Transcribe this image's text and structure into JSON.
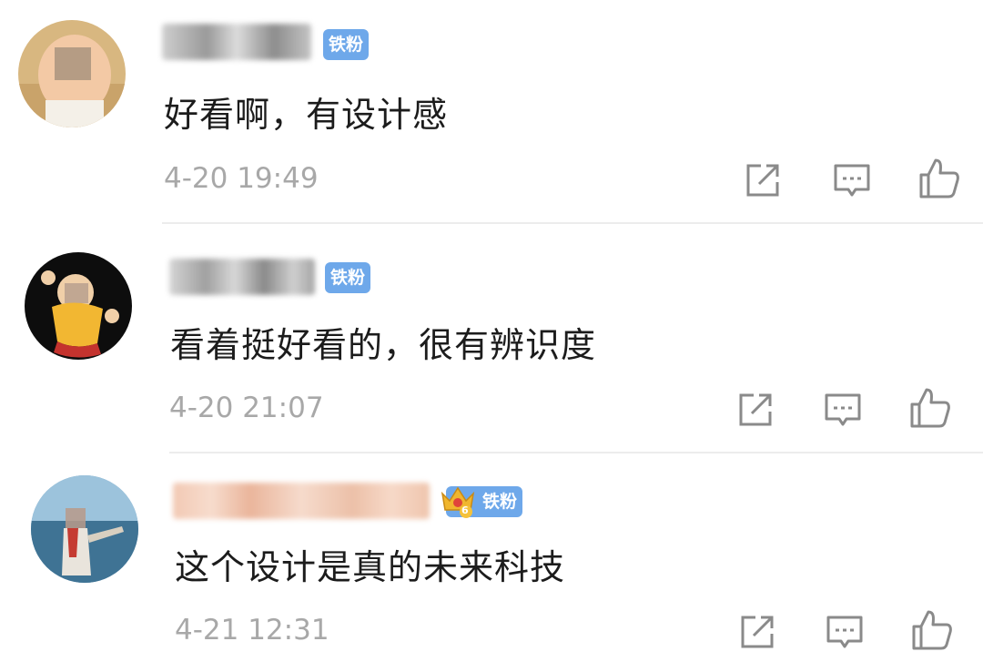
{
  "comments": [
    {
      "badge": "铁粉",
      "text": "好看啊，有设计感",
      "time": "4-20 19:49",
      "badge_has_crown": false
    },
    {
      "badge": "铁粉",
      "text": "看着挺好看的，很有辨识度",
      "time": "4-20 21:07",
      "badge_has_crown": false
    },
    {
      "badge": "铁粉",
      "text": "这个设计是真的未来科技",
      "time": "4-21 12:31",
      "badge_has_crown": true,
      "crown_level": "6"
    }
  ],
  "icons": {
    "share": "share-icon",
    "reply": "comment-icon",
    "like": "thumbs-up-icon"
  },
  "colors": {
    "badge_bg": "#6ea8ea",
    "time_text": "#a8a8a8",
    "comment_text": "#1c1c1c",
    "icon_stroke": "#8a8a8a"
  }
}
